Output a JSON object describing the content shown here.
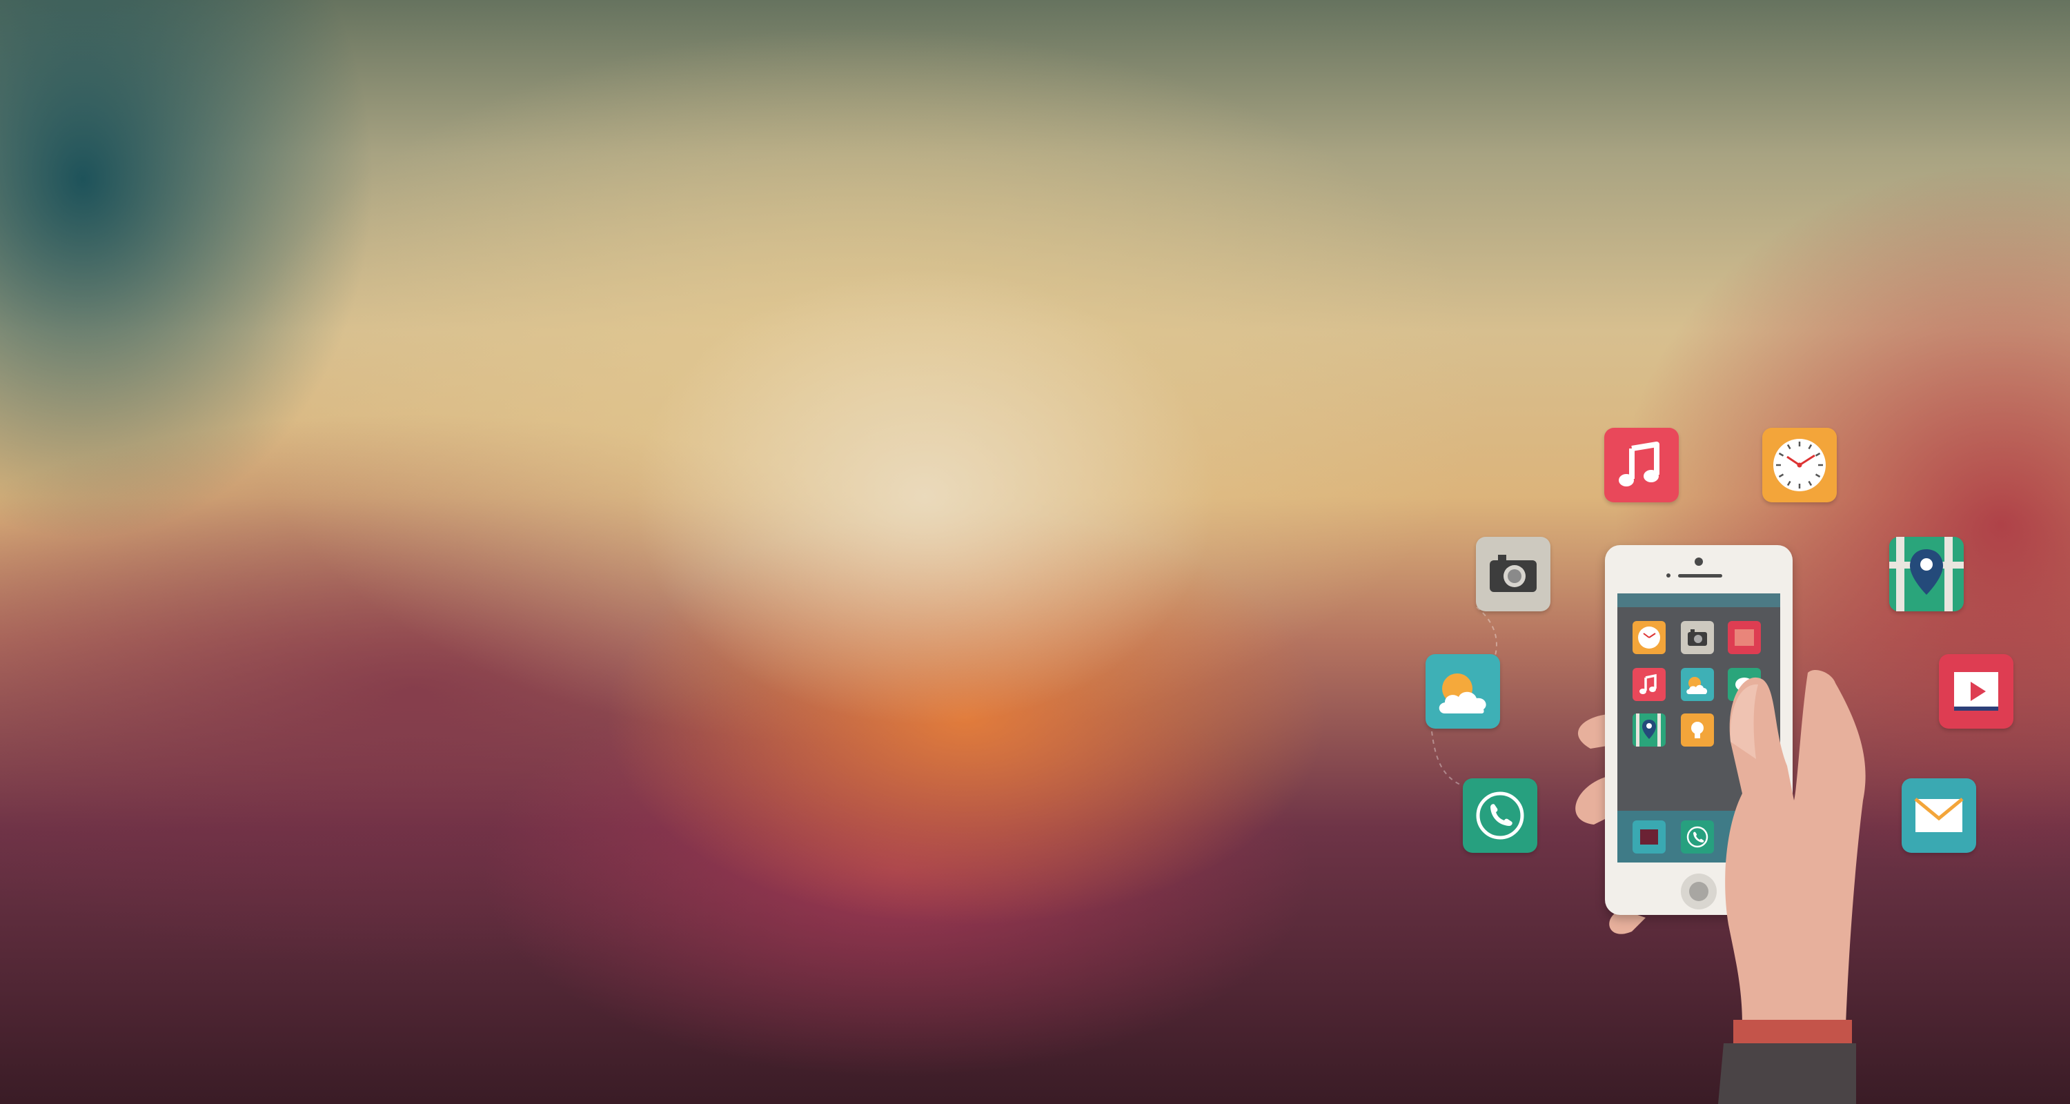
{
  "scene": {
    "description_tag": "",
    "colors": {
      "music": "#e9485a",
      "clock": "#f3a53a",
      "camera": "#cdc9bf",
      "maps": "#2aa57b",
      "weather": "#3eb0b6",
      "video": "#de3d52",
      "phone": "#27a07f",
      "mail": "#3aa9b2",
      "skin": "#e7b09c",
      "sleeve": "#4a4446",
      "cuff": "#c4544a"
    },
    "icons": [
      "music-icon",
      "clock-icon",
      "camera-icon",
      "maps-icon",
      "weather-icon",
      "video-icon",
      "phone-icon",
      "mail-icon"
    ]
  }
}
